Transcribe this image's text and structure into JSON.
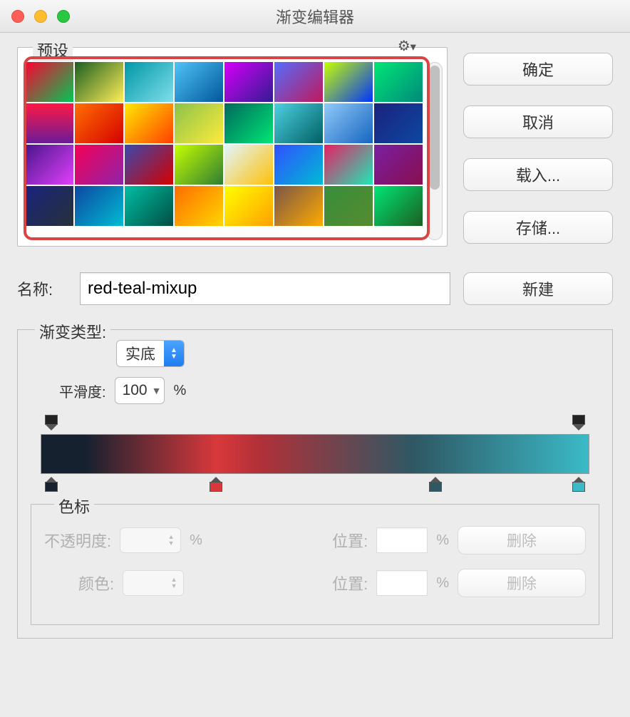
{
  "window": {
    "title": "渐变编辑器"
  },
  "presets": {
    "label": "预设",
    "swatches": [
      "linear-gradient(135deg,#ff0033,#00c853)",
      "linear-gradient(135deg,#1b5e20,#ffee58)",
      "linear-gradient(135deg,#0097a7,#80deea)",
      "linear-gradient(135deg,#4fc3f7,#01579b)",
      "linear-gradient(135deg,#d500f9,#311b92)",
      "linear-gradient(135deg,#536dfe,#c2185b)",
      "linear-gradient(135deg,#c6ff00,#0033ff)",
      "linear-gradient(135deg,#00e676,#00897b)",
      "linear-gradient(180deg,#ff1744,#6a1b9a)",
      "linear-gradient(135deg,#ff6f00,#d50000)",
      "linear-gradient(135deg,#ffea00,#ff3d00)",
      "linear-gradient(135deg,#8bc34a,#ffeb3b)",
      "linear-gradient(135deg,#00695c,#00e676)",
      "linear-gradient(135deg,#4dd0e1,#006064)",
      "linear-gradient(135deg,#90caf9,#1565c0)",
      "linear-gradient(135deg,#1a237e,#0d47a1)",
      "linear-gradient(135deg,#4a148c,#e040fb)",
      "linear-gradient(135deg,#f50057,#8e24aa)",
      "linear-gradient(135deg,#3949ab,#d50000)",
      "linear-gradient(135deg,#c6ff00,#2e7d32)",
      "linear-gradient(135deg,#e1f5fe,#ffc107)",
      "linear-gradient(135deg,#304ffe,#00bcd4)",
      "linear-gradient(135deg,#e91e63,#1de9b6)",
      "linear-gradient(135deg,#7b1fa2,#880e4f)",
      "linear-gradient(135deg,#1a237e,#263238)",
      "linear-gradient(135deg,#0d47a1,#00bcd4)",
      "linear-gradient(135deg,#00bfa5,#004d40)",
      "linear-gradient(135deg,#ff6d00,#ffd600)",
      "linear-gradient(135deg,#ffff00,#ffa000)",
      "linear-gradient(135deg,#795548,#ffab00)",
      "linear-gradient(135deg,#388e3c,#558b2f)",
      "linear-gradient(135deg,#00e676,#1b5e20)"
    ]
  },
  "buttons": {
    "ok": "确定",
    "cancel": "取消",
    "load": "载入...",
    "save": "存储...",
    "new": "新建"
  },
  "name": {
    "label": "名称:",
    "value": "red-teal-mixup"
  },
  "gradient": {
    "type_label": "渐变类型:",
    "type_value": "实底",
    "smoothness_label": "平滑度:",
    "smoothness_value": "100",
    "smoothness_unit": "%"
  },
  "stops": {
    "group_label": "色标",
    "opacity_label": "不透明度:",
    "opacity_unit": "%",
    "position_label": "位置:",
    "position_unit": "%",
    "color_label": "颜色:",
    "delete_label": "删除"
  }
}
